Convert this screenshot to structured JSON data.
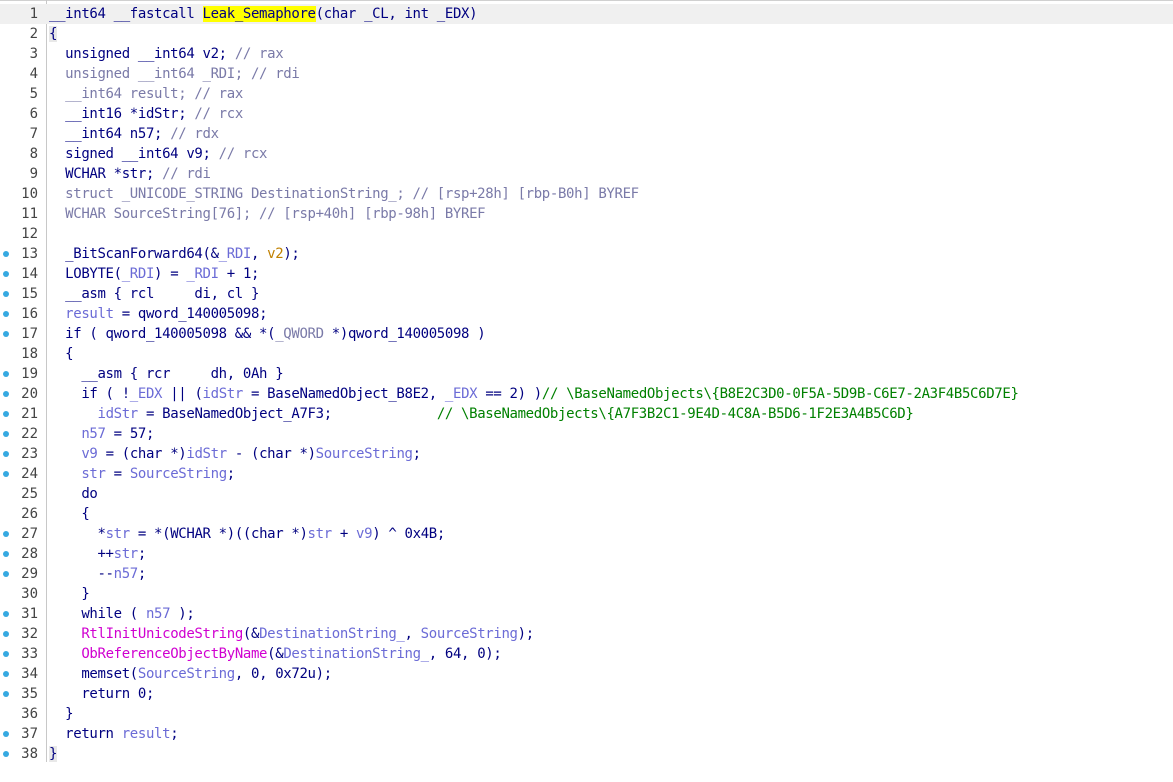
{
  "function_name": "Leak_Semaphore",
  "lines": [
    {
      "n": "1",
      "bp": false,
      "tokens": [
        {
          "t": "__int64 __fastcall ",
          "c": "kw"
        },
        {
          "t": "Leak_Semaphore",
          "c": "hl"
        },
        {
          "t": "(char _CL, int _EDX)",
          "c": "kw"
        }
      ]
    },
    {
      "n": "2",
      "bp": false,
      "tokens": [
        {
          "t": "{",
          "c": "brace"
        }
      ]
    },
    {
      "n": "3",
      "bp": false,
      "tokens": [
        {
          "t": "  unsigned __int64 v2; ",
          "c": "kw"
        },
        {
          "t": "// rax",
          "c": "cmt"
        }
      ]
    },
    {
      "n": "4",
      "bp": false,
      "tokens": [
        {
          "t": "  unsigned __int64 _RDI; ",
          "c": "cmt"
        },
        {
          "t": "// rdi",
          "c": "cmt"
        }
      ]
    },
    {
      "n": "5",
      "bp": false,
      "tokens": [
        {
          "t": "  __int64 result; ",
          "c": "cmt"
        },
        {
          "t": "// rax",
          "c": "cmt"
        }
      ]
    },
    {
      "n": "6",
      "bp": false,
      "tokens": [
        {
          "t": "  __int16 *idStr; ",
          "c": "kw"
        },
        {
          "t": "// rcx",
          "c": "cmt"
        }
      ]
    },
    {
      "n": "7",
      "bp": false,
      "tokens": [
        {
          "t": "  __int64 n57; ",
          "c": "kw"
        },
        {
          "t": "// rdx",
          "c": "cmt"
        }
      ]
    },
    {
      "n": "8",
      "bp": false,
      "tokens": [
        {
          "t": "  signed __int64 v9; ",
          "c": "kw"
        },
        {
          "t": "// rcx",
          "c": "cmt"
        }
      ]
    },
    {
      "n": "9",
      "bp": false,
      "tokens": [
        {
          "t": "  WCHAR *str; ",
          "c": "kw"
        },
        {
          "t": "// rdi",
          "c": "cmt"
        }
      ]
    },
    {
      "n": "10",
      "bp": false,
      "tokens": [
        {
          "t": "  struct _UNICODE_STRING DestinationString_; ",
          "c": "cmt"
        },
        {
          "t": "// [rsp+28h] [rbp-B0h] BYREF",
          "c": "cmt"
        }
      ]
    },
    {
      "n": "11",
      "bp": false,
      "tokens": [
        {
          "t": "  WCHAR SourceString[76]; ",
          "c": "cmt"
        },
        {
          "t": "// [rsp+40h] [rbp-98h] BYREF",
          "c": "cmt"
        }
      ]
    },
    {
      "n": "12",
      "bp": false,
      "tokens": [
        {
          "t": "",
          "c": "kw"
        }
      ]
    },
    {
      "n": "13",
      "bp": true,
      "tokens": [
        {
          "t": "  _BitScanForward64(&",
          "c": "kw"
        },
        {
          "t": "_RDI",
          "c": "var"
        },
        {
          "t": ", ",
          "c": "kw"
        },
        {
          "t": "v2",
          "c": "arg"
        },
        {
          "t": ");",
          "c": "kw"
        }
      ]
    },
    {
      "n": "14",
      "bp": true,
      "tokens": [
        {
          "t": "  LOBYTE(",
          "c": "kw"
        },
        {
          "t": "_RDI",
          "c": "var"
        },
        {
          "t": ") = ",
          "c": "kw"
        },
        {
          "t": "_RDI",
          "c": "var"
        },
        {
          "t": " + 1;",
          "c": "kw"
        }
      ]
    },
    {
      "n": "15",
      "bp": true,
      "tokens": [
        {
          "t": "  __asm { rcl     di, cl }",
          "c": "kw"
        }
      ]
    },
    {
      "n": "16",
      "bp": true,
      "tokens": [
        {
          "t": "  ",
          "c": "kw"
        },
        {
          "t": "result",
          "c": "var"
        },
        {
          "t": " = qword_140005098;",
          "c": "kw"
        }
      ]
    },
    {
      "n": "17",
      "bp": true,
      "tokens": [
        {
          "t": "  if ( qword_140005098 && *(",
          "c": "kw"
        },
        {
          "t": "_QWORD",
          "c": "cmt"
        },
        {
          "t": " *)qword_140005098 )",
          "c": "kw"
        }
      ]
    },
    {
      "n": "18",
      "bp": false,
      "tokens": [
        {
          "t": "  {",
          "c": "kw"
        }
      ]
    },
    {
      "n": "19",
      "bp": true,
      "tokens": [
        {
          "t": "    __asm { rcr     dh, 0Ah }",
          "c": "kw"
        }
      ]
    },
    {
      "n": "20",
      "bp": true,
      "tokens": [
        {
          "t": "    if ( !",
          "c": "kw"
        },
        {
          "t": "_EDX",
          "c": "var"
        },
        {
          "t": " || (",
          "c": "kw"
        },
        {
          "t": "idStr",
          "c": "var"
        },
        {
          "t": " = BaseNamedObject_B8E2, ",
          "c": "kw"
        },
        {
          "t": "_EDX",
          "c": "var"
        },
        {
          "t": " == 2) )",
          "c": "kw"
        },
        {
          "t": "// \\BaseNamedObjects\\{B8E2C3D0-0F5A-5D9B-C6E7-2A3F4B5C6D7E}",
          "c": "gcmt"
        }
      ]
    },
    {
      "n": "21",
      "bp": true,
      "tokens": [
        {
          "t": "      ",
          "c": "kw"
        },
        {
          "t": "idStr",
          "c": "var"
        },
        {
          "t": " = BaseNamedObject_A7F3;             ",
          "c": "kw"
        },
        {
          "t": "// \\BaseNamedObjects\\{A7F3B2C1-9E4D-4C8A-B5D6-1F2E3A4B5C6D}",
          "c": "gcmt"
        }
      ]
    },
    {
      "n": "22",
      "bp": true,
      "tokens": [
        {
          "t": "    ",
          "c": "kw"
        },
        {
          "t": "n57",
          "c": "var"
        },
        {
          "t": " = 57;",
          "c": "kw"
        }
      ]
    },
    {
      "n": "23",
      "bp": true,
      "tokens": [
        {
          "t": "    ",
          "c": "kw"
        },
        {
          "t": "v9",
          "c": "var"
        },
        {
          "t": " = (char *)",
          "c": "kw"
        },
        {
          "t": "idStr",
          "c": "var"
        },
        {
          "t": " - (char *)",
          "c": "kw"
        },
        {
          "t": "SourceString",
          "c": "var"
        },
        {
          "t": ";",
          "c": "kw"
        }
      ]
    },
    {
      "n": "24",
      "bp": true,
      "tokens": [
        {
          "t": "    ",
          "c": "kw"
        },
        {
          "t": "str",
          "c": "var"
        },
        {
          "t": " = ",
          "c": "kw"
        },
        {
          "t": "SourceString",
          "c": "var"
        },
        {
          "t": ";",
          "c": "kw"
        }
      ]
    },
    {
      "n": "25",
      "bp": false,
      "tokens": [
        {
          "t": "    do",
          "c": "kw"
        }
      ]
    },
    {
      "n": "26",
      "bp": false,
      "tokens": [
        {
          "t": "    {",
          "c": "kw"
        }
      ]
    },
    {
      "n": "27",
      "bp": true,
      "tokens": [
        {
          "t": "      *",
          "c": "kw"
        },
        {
          "t": "str",
          "c": "var"
        },
        {
          "t": " = *(WCHAR *)((char *)",
          "c": "kw"
        },
        {
          "t": "str",
          "c": "var"
        },
        {
          "t": " + ",
          "c": "kw"
        },
        {
          "t": "v9",
          "c": "var"
        },
        {
          "t": ") ^ 0x4B;",
          "c": "kw"
        }
      ]
    },
    {
      "n": "28",
      "bp": true,
      "tokens": [
        {
          "t": "      ++",
          "c": "kw"
        },
        {
          "t": "str",
          "c": "var"
        },
        {
          "t": ";",
          "c": "kw"
        }
      ]
    },
    {
      "n": "29",
      "bp": true,
      "tokens": [
        {
          "t": "      --",
          "c": "kw"
        },
        {
          "t": "n57",
          "c": "var"
        },
        {
          "t": ";",
          "c": "kw"
        }
      ]
    },
    {
      "n": "30",
      "bp": false,
      "tokens": [
        {
          "t": "    }",
          "c": "kw"
        }
      ]
    },
    {
      "n": "31",
      "bp": true,
      "tokens": [
        {
          "t": "    while ( ",
          "c": "kw"
        },
        {
          "t": "n57",
          "c": "var"
        },
        {
          "t": " );",
          "c": "kw"
        }
      ]
    },
    {
      "n": "32",
      "bp": true,
      "tokens": [
        {
          "t": "    ",
          "c": "kw"
        },
        {
          "t": "RtlInitUnicodeString",
          "c": "fn"
        },
        {
          "t": "(&",
          "c": "kw"
        },
        {
          "t": "DestinationString_",
          "c": "var"
        },
        {
          "t": ", ",
          "c": "kw"
        },
        {
          "t": "SourceString",
          "c": "var"
        },
        {
          "t": ");",
          "c": "kw"
        }
      ]
    },
    {
      "n": "33",
      "bp": true,
      "tokens": [
        {
          "t": "    ",
          "c": "kw"
        },
        {
          "t": "ObReferenceObjectByName",
          "c": "fn"
        },
        {
          "t": "(&",
          "c": "kw"
        },
        {
          "t": "DestinationString_",
          "c": "var"
        },
        {
          "t": ", 64, 0);",
          "c": "kw"
        }
      ]
    },
    {
      "n": "34",
      "bp": true,
      "tokens": [
        {
          "t": "    memset(",
          "c": "kw"
        },
        {
          "t": "SourceString",
          "c": "var"
        },
        {
          "t": ", 0, 0x72u);",
          "c": "kw"
        }
      ]
    },
    {
      "n": "35",
      "bp": true,
      "tokens": [
        {
          "t": "    return 0;",
          "c": "kw"
        }
      ]
    },
    {
      "n": "36",
      "bp": false,
      "tokens": [
        {
          "t": "  }",
          "c": "kw"
        }
      ]
    },
    {
      "n": "37",
      "bp": true,
      "tokens": [
        {
          "t": "  return ",
          "c": "kw"
        },
        {
          "t": "result",
          "c": "var"
        },
        {
          "t": ";",
          "c": "kw"
        }
      ]
    },
    {
      "n": "38",
      "bp": true,
      "tokens": [
        {
          "t": "}",
          "c": "brace"
        }
      ]
    }
  ]
}
